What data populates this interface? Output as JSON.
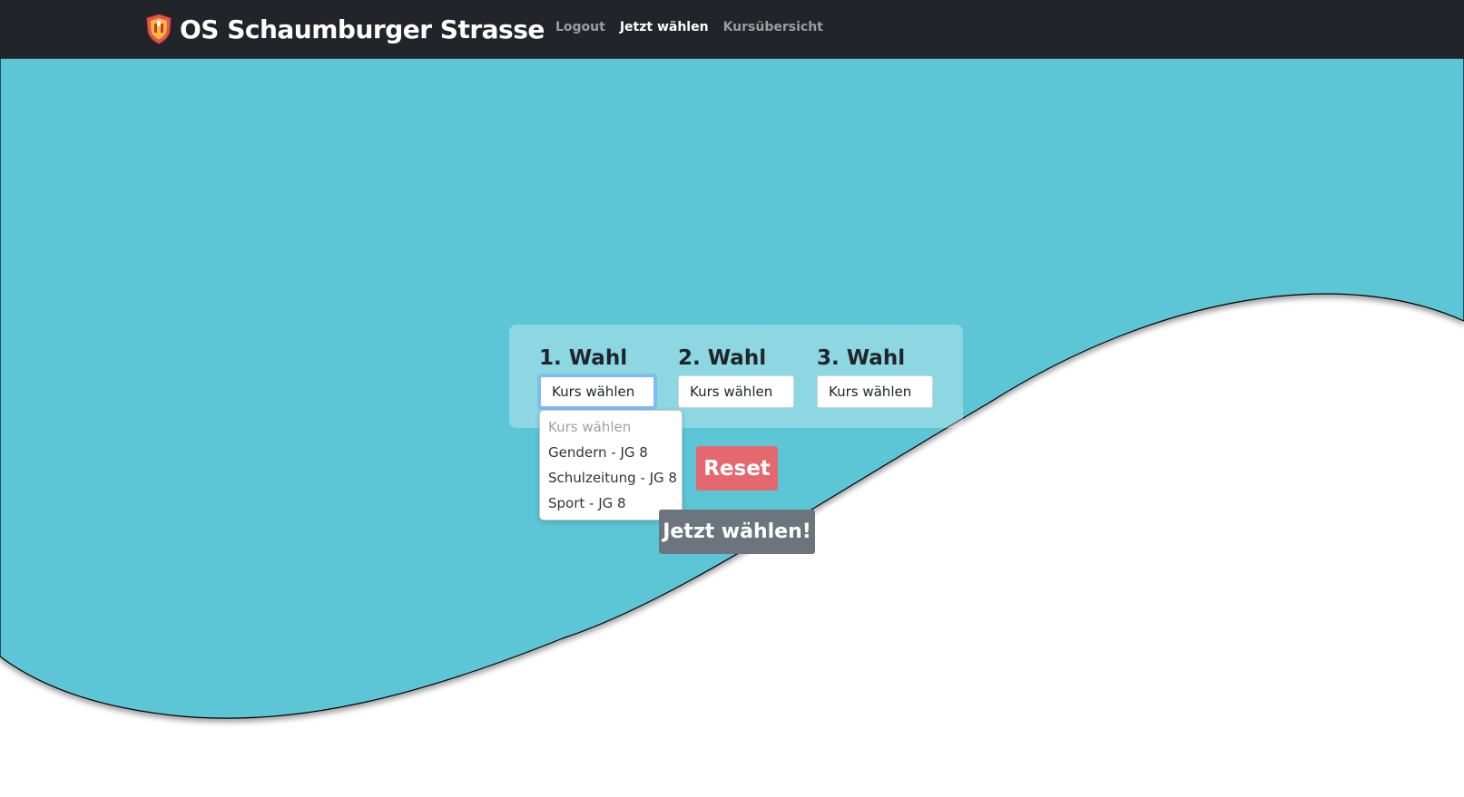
{
  "colors": {
    "navbar_bg": "#212529",
    "background_teal": "#5bc6d6",
    "reset_button": "#e4686e",
    "submit_button": "#6c757d"
  },
  "header": {
    "logo_icon": "shield-logo-icon",
    "title": "OS Schaumburger Strasse",
    "nav": [
      {
        "label": "Logout",
        "active": false
      },
      {
        "label": "Jetzt wählen",
        "active": true
      },
      {
        "label": "Kursübersicht",
        "active": false
      }
    ]
  },
  "form": {
    "choices": [
      {
        "label": "1. Wahl",
        "value": "Kurs wählen",
        "focused": true
      },
      {
        "label": "2. Wahl",
        "value": "Kurs wählen",
        "focused": false
      },
      {
        "label": "3. Wahl",
        "value": "Kurs wählen",
        "focused": false
      }
    ],
    "dropdown_options": [
      "Kurs wählen",
      "Gendern - JG 8",
      "Schulzeitung - JG 8",
      "Sport - JG 8"
    ],
    "reset_label": "Reset",
    "submit_label": "Jetzt wählen!"
  }
}
